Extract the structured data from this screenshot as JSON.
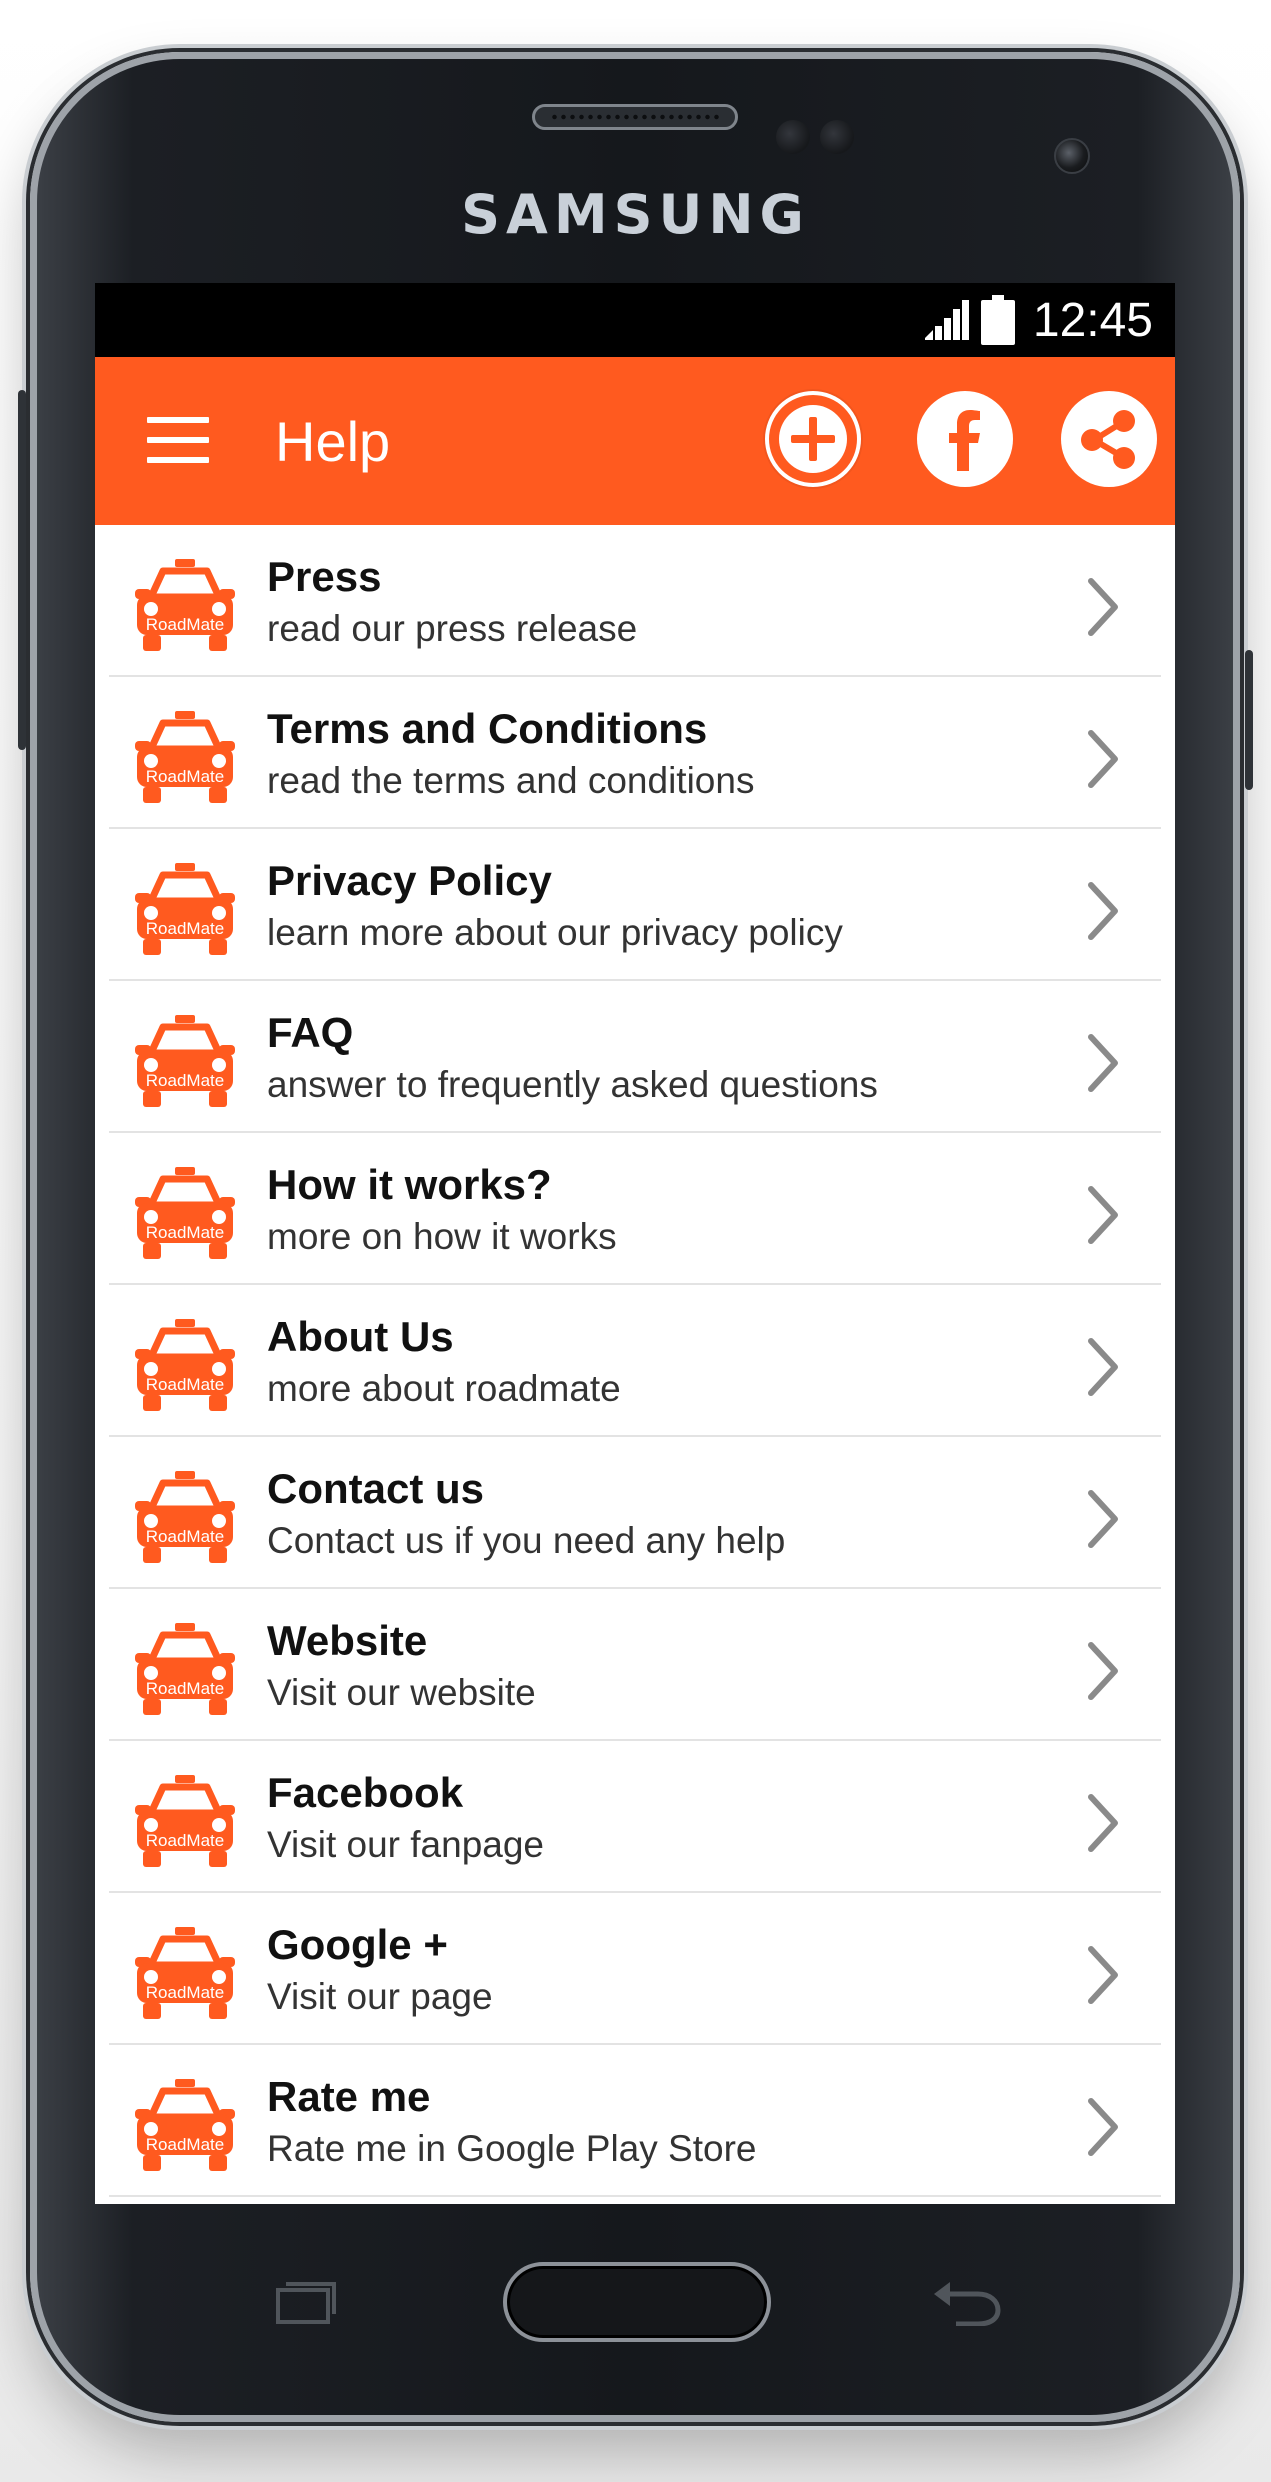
{
  "device": {
    "brand": "SAMSUNG"
  },
  "status_bar": {
    "time": "12:45",
    "icons": [
      "signal-icon",
      "battery-icon"
    ]
  },
  "app_bar": {
    "title": "Help",
    "menu_icon": "hamburger-icon",
    "actions": [
      "add-icon",
      "facebook-icon",
      "share-icon"
    ],
    "color": "#ff5a1f"
  },
  "list_icon_label": "RoadMate",
  "items": [
    {
      "title": "Press",
      "subtitle": "read our press release"
    },
    {
      "title": "Terms and Conditions",
      "subtitle": "read the terms and conditions"
    },
    {
      "title": "Privacy Policy",
      "subtitle": "learn more about our privacy policy"
    },
    {
      "title": "FAQ",
      "subtitle": "answer to frequently asked questions"
    },
    {
      "title": "How it works?",
      "subtitle": "more on how it works"
    },
    {
      "title": "About Us",
      "subtitle": "more about roadmate"
    },
    {
      "title": "Contact us",
      "subtitle": "Contact us if you need any help"
    },
    {
      "title": "Website",
      "subtitle": "Visit our website"
    },
    {
      "title": "Facebook",
      "subtitle": "Visit our fanpage"
    },
    {
      "title": "Google +",
      "subtitle": "Visit our page"
    },
    {
      "title": "Rate me",
      "subtitle": "Rate me in Google Play Store"
    }
  ],
  "accent_color": "#ff5a1f",
  "chevron_color": "#8a8a8a"
}
